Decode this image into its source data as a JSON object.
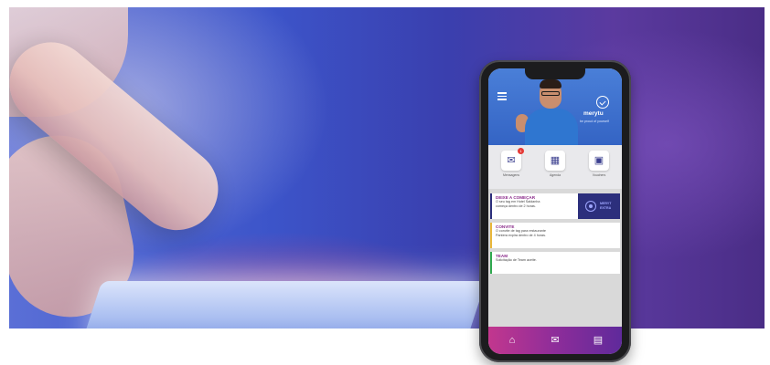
{
  "app": {
    "brand_name": "merytu",
    "brand_tagline": "be proud of yourself"
  },
  "quick_actions": [
    {
      "label": "Mensagens",
      "icon": "mail-icon",
      "badge": "1"
    },
    {
      "label": "Agenda",
      "icon": "calendar-icon"
    },
    {
      "label": "Vouchers",
      "icon": "qr-code-icon"
    }
  ],
  "cards": [
    {
      "title": "DEIXE A COMEÇAR",
      "lines": [
        "O seu tag em Hotel Saldanha",
        "começa dentro de 2 horas."
      ],
      "side_text": "MERYT EXTRA",
      "accent": "#2c2f7c"
    },
    {
      "title": "CONVITE",
      "lines": [
        "O convite de tag para restaurante",
        "Pantera expira dentro de 4 horas."
      ],
      "accent": "#e8b63a"
    },
    {
      "title": "TEAM",
      "lines": [
        "Solicitação de Team aceite."
      ],
      "accent": "#2fa84f"
    }
  ],
  "bottom_nav": [
    {
      "icon": "home-icon"
    },
    {
      "icon": "inbox-icon"
    },
    {
      "icon": "wallet-icon"
    }
  ],
  "colors": {
    "header_blue": "#3464c4",
    "nav_gradient_start": "#c2378e",
    "nav_gradient_end": "#5f2a9b",
    "card_title": "#8a2a8a"
  }
}
